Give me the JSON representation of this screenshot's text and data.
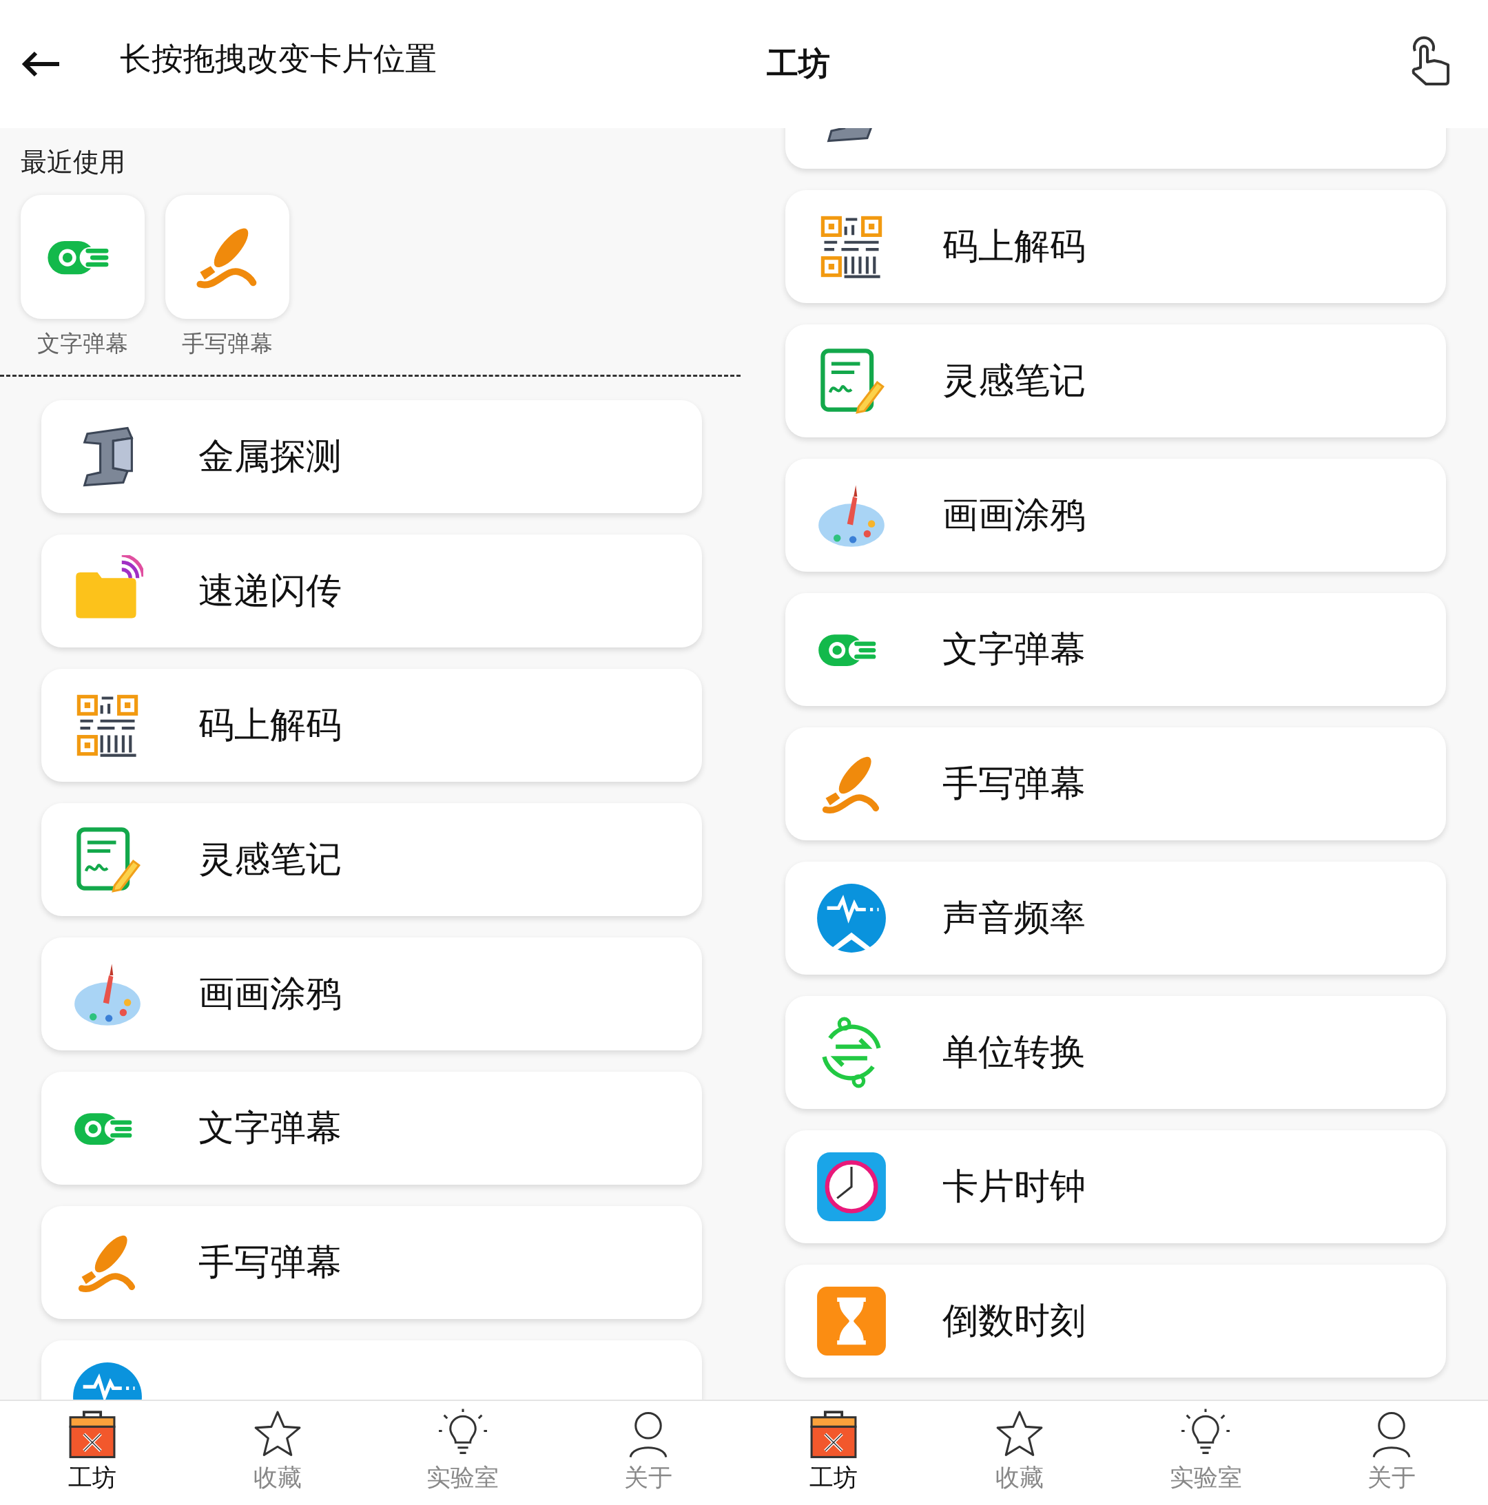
{
  "panels": [
    {
      "header": {
        "kind": "edit",
        "title": "长按拖拽改变卡片位置"
      },
      "recent": {
        "title": "最近使用",
        "items": [
          {
            "kind": "danmaku",
            "label": "文字弹幕"
          },
          {
            "kind": "brush",
            "label": "手写弹幕"
          }
        ]
      },
      "cards": [
        {
          "kind": "metal",
          "label": "金属探测"
        },
        {
          "kind": "folder",
          "label": "速递闪传"
        },
        {
          "kind": "qr",
          "label": "码上解码"
        },
        {
          "kind": "notes",
          "label": "灵感笔记"
        },
        {
          "kind": "palette",
          "label": "画画涂鸦"
        },
        {
          "kind": "danmaku",
          "label": "文字弹幕"
        },
        {
          "kind": "brush",
          "label": "手写弹幕"
        },
        {
          "kind": "sound"
        }
      ],
      "nav": [
        {
          "kind": "toolbox",
          "label": "工坊",
          "selected": true
        },
        {
          "kind": "star",
          "label": "收藏",
          "selected": false
        },
        {
          "kind": "bulb",
          "label": "实验室",
          "selected": false
        },
        {
          "kind": "person",
          "label": "关于",
          "selected": false
        }
      ]
    },
    {
      "header": {
        "kind": "main",
        "title": "工坊"
      },
      "cards": [
        {
          "kind": "metal"
        },
        {
          "kind": "qr",
          "label": "码上解码"
        },
        {
          "kind": "notes",
          "label": "灵感笔记"
        },
        {
          "kind": "palette",
          "label": "画画涂鸦"
        },
        {
          "kind": "danmaku",
          "label": "文字弹幕"
        },
        {
          "kind": "brush",
          "label": "手写弹幕"
        },
        {
          "kind": "sound",
          "label": "声音频率"
        },
        {
          "kind": "convert",
          "label": "单位转换"
        },
        {
          "kind": "clock",
          "label": "卡片时钟"
        },
        {
          "kind": "hourglass",
          "label": "倒数时刻"
        }
      ],
      "nav": [
        {
          "kind": "toolbox",
          "label": "工坊",
          "selected": true
        },
        {
          "kind": "star",
          "label": "收藏",
          "selected": false
        },
        {
          "kind": "bulb",
          "label": "实验室",
          "selected": false
        },
        {
          "kind": "person",
          "label": "关于",
          "selected": false
        }
      ]
    }
  ]
}
